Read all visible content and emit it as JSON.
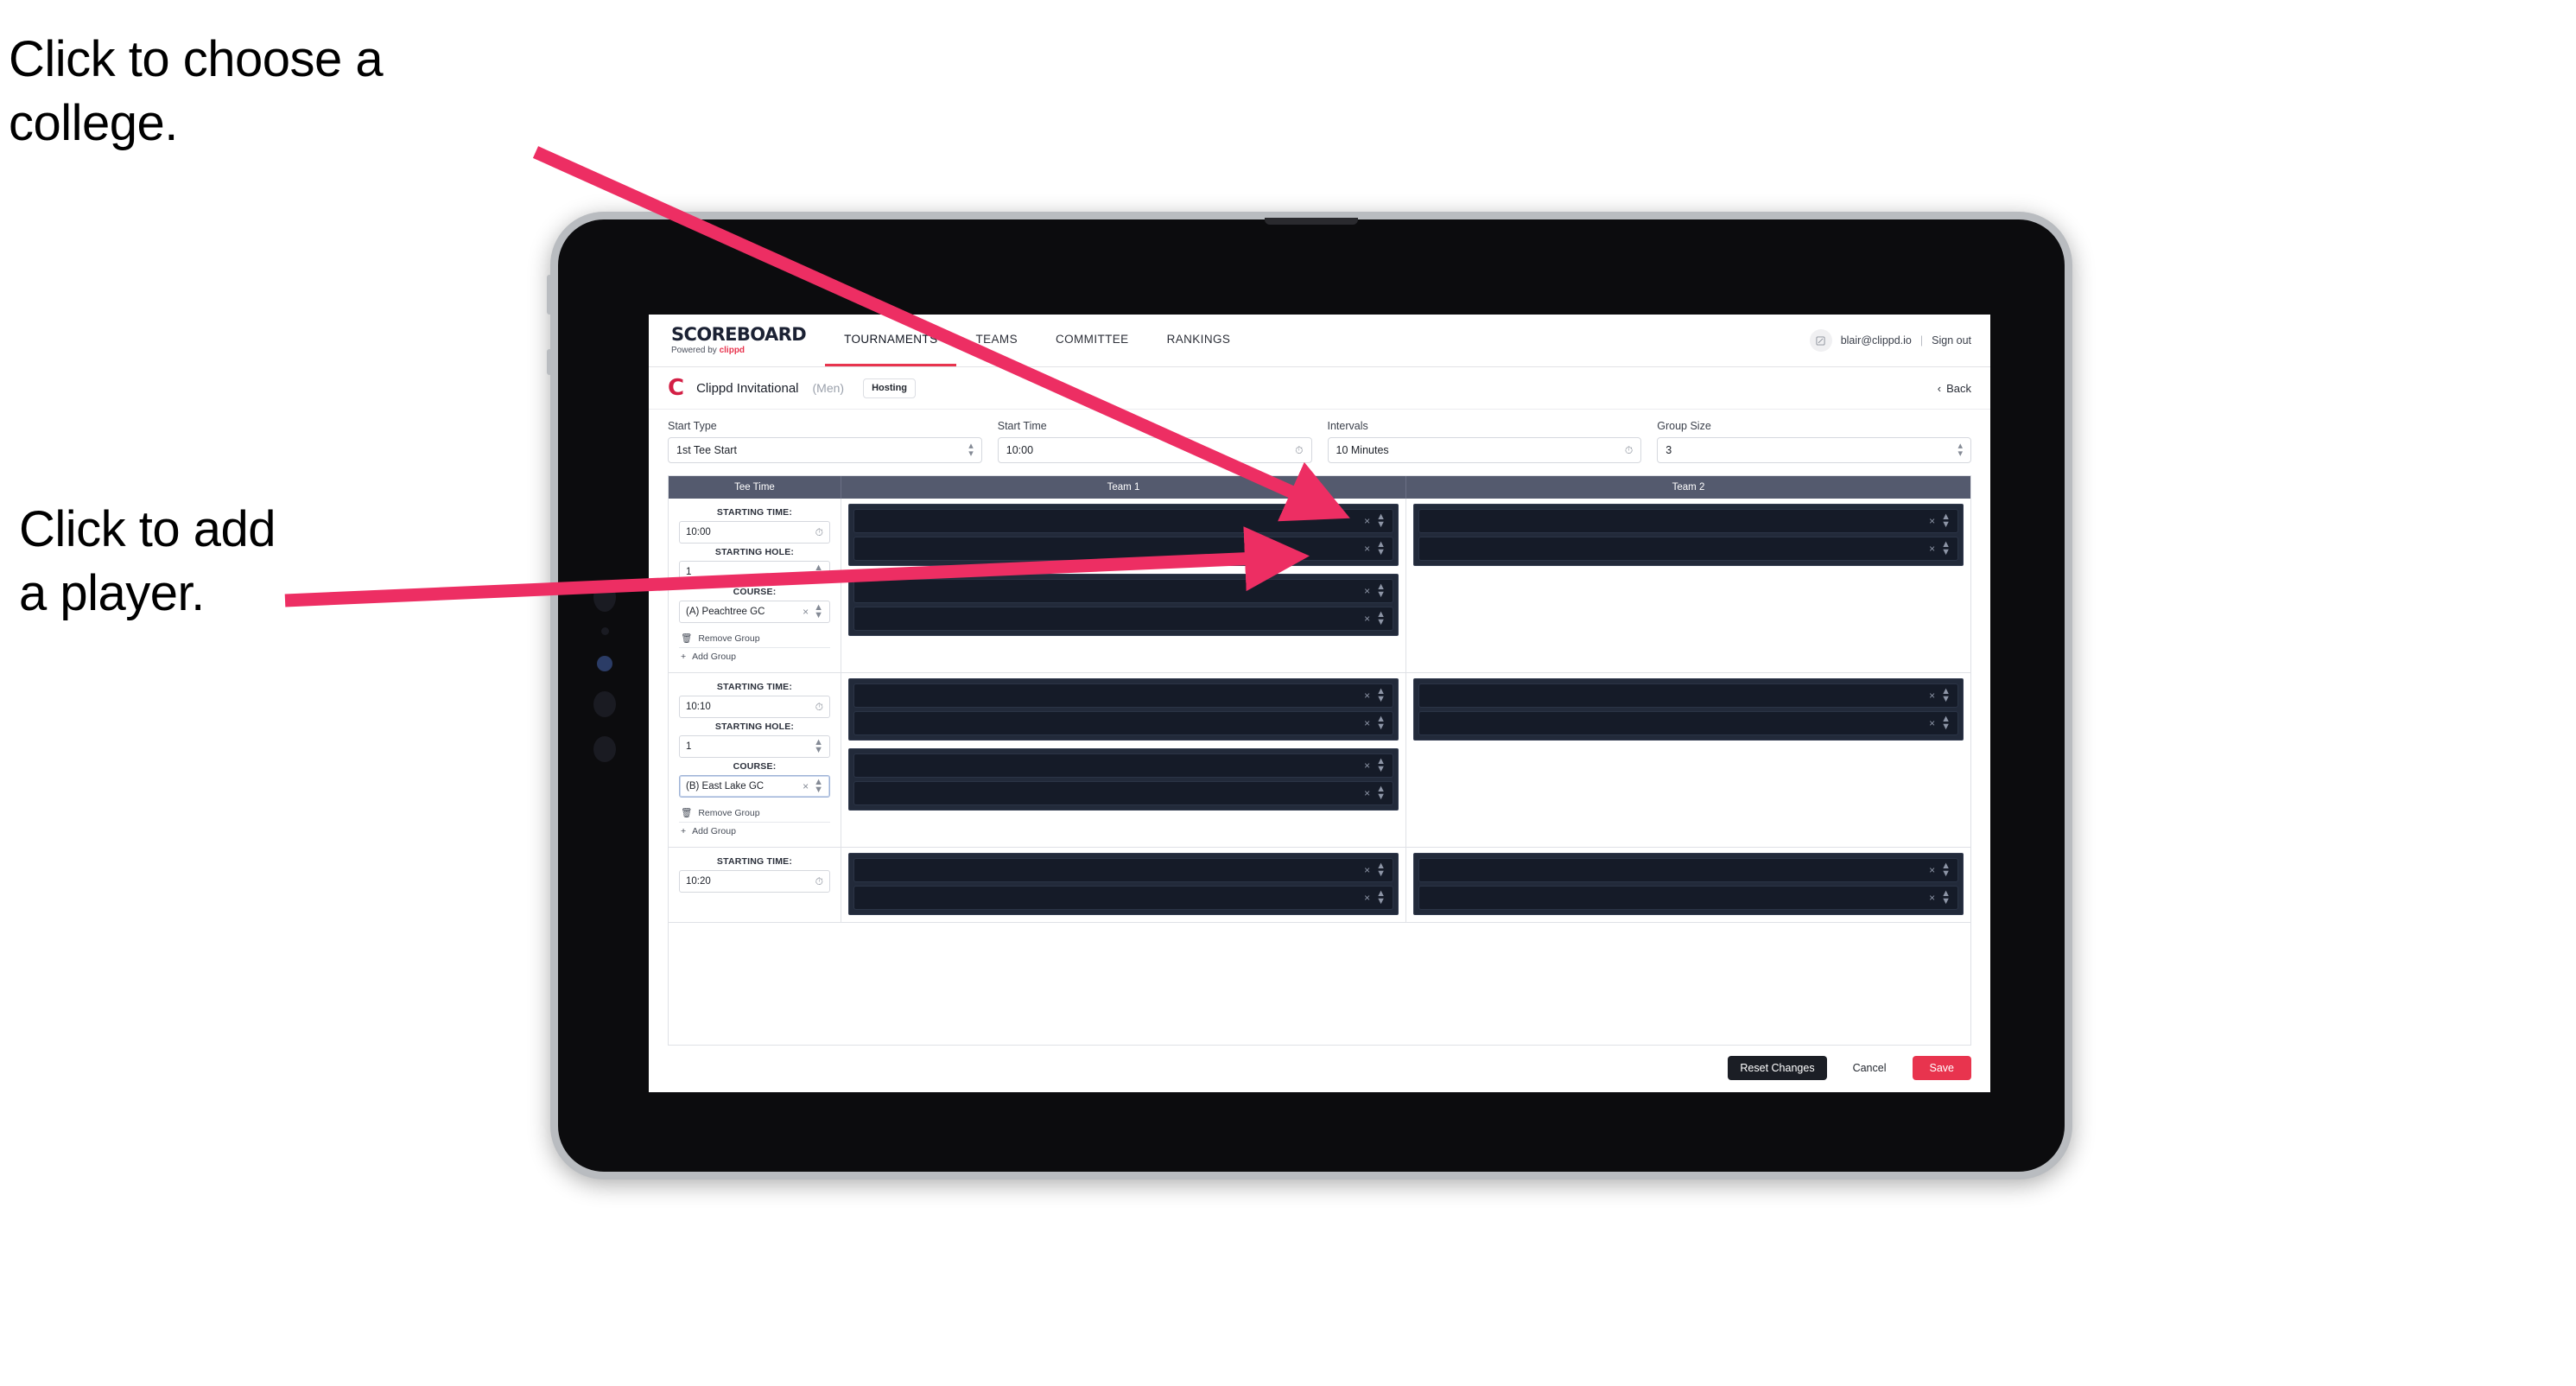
{
  "annotations": {
    "college": "Click to choose a\ncollege.",
    "player": "Click to add\na player.",
    "arrow_color": "#ED2E63"
  },
  "nav": {
    "brand_title": "SCOREBOARD",
    "brand_sub_prefix": "Powered by ",
    "brand_sub_mark": "clippd",
    "tabs": [
      {
        "label": "TOURNAMENTS",
        "active": true
      },
      {
        "label": "TEAMS",
        "active": false
      },
      {
        "label": "COMMITTEE",
        "active": false
      },
      {
        "label": "RANKINGS",
        "active": false
      }
    ],
    "avatar_icon": "user-avatar-icon",
    "account_email": "blair@clippd.io",
    "separator": "|",
    "sign_out": "Sign out"
  },
  "tournament_bar": {
    "logo_letter": "C",
    "name": "Clippd Invitational",
    "gender": "(Men)",
    "hosting_badge": "Hosting",
    "back_chevron": "‹",
    "back_label": "Back"
  },
  "settings": {
    "fields": [
      {
        "label": "Start Type",
        "value": "1st Tee Start",
        "icon": "stepper-icon"
      },
      {
        "label": "Start Time",
        "value": "10:00",
        "icon": "clock-icon"
      },
      {
        "label": "Intervals",
        "value": "10 Minutes",
        "icon": "clock-icon"
      },
      {
        "label": "Group Size",
        "value": "3",
        "icon": "stepper-icon"
      }
    ]
  },
  "table": {
    "headers": [
      "Tee Time",
      "Team 1",
      "Team 2"
    ],
    "labels": {
      "starting_time": "STARTING TIME:",
      "starting_hole": "STARTING HOLE:",
      "course": "COURSE:",
      "remove_group": "Remove Group",
      "add_group": "Add Group",
      "remove_icon": "trash-icon",
      "add_icon": "plus-icon",
      "clock_icon": "clock-icon",
      "stepper_icon": "stepper-icon",
      "clear_icon": "close-x-icon"
    },
    "rows": [
      {
        "starting_time": "10:00",
        "starting_hole": "1",
        "course": "(A) Peachtree GC",
        "course_focused": false,
        "show_group_links": true,
        "team1_groups": [
          {
            "slots": [
              "",
              ""
            ]
          },
          {
            "slots": [
              "",
              ""
            ]
          }
        ],
        "team2_groups": [
          {
            "slots": [
              "",
              ""
            ]
          }
        ]
      },
      {
        "starting_time": "10:10",
        "starting_hole": "1",
        "course": "(B) East Lake GC",
        "course_focused": true,
        "show_group_links": true,
        "team1_groups": [
          {
            "slots": [
              "",
              ""
            ]
          },
          {
            "slots": [
              "",
              ""
            ]
          }
        ],
        "team2_groups": [
          {
            "slots": [
              "",
              ""
            ]
          }
        ]
      },
      {
        "starting_time": "10:20",
        "starting_hole": "",
        "course": "",
        "course_focused": false,
        "show_group_links": false,
        "team1_groups": [
          {
            "slots": [
              "",
              ""
            ]
          }
        ],
        "team2_groups": [
          {
            "slots": [
              "",
              ""
            ]
          }
        ]
      }
    ]
  },
  "footer": {
    "reset_label": "Reset Changes",
    "cancel_label": "Cancel",
    "save_label": "Save",
    "save_color": "#E8344E"
  }
}
